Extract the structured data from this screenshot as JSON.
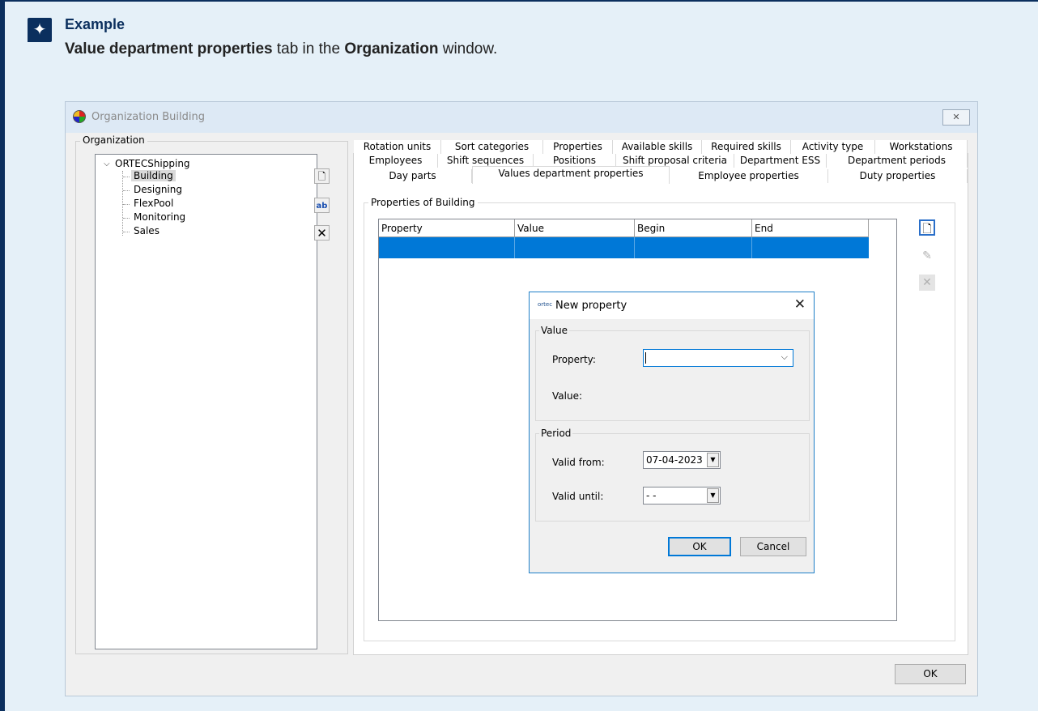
{
  "callout": {
    "icon": "star-icon",
    "title": "Example",
    "text_bold1": "Value department properties",
    "text_mid": " tab in the ",
    "text_bold2": "Organization",
    "text_end": " window."
  },
  "window": {
    "title": "Organization Building",
    "close_label": "X"
  },
  "organization": {
    "group_label": "Organization",
    "root": "ORTECShipping",
    "children": [
      "Building",
      "Designing",
      "FlexPool",
      "Monitoring",
      "Sales"
    ],
    "selected": "Building"
  },
  "tabs": {
    "row1": [
      "Rotation units",
      "Sort categories",
      "Properties",
      "Available skills",
      "Required skills",
      "Activity type",
      "Workstations"
    ],
    "row2": [
      "Employees",
      "Shift sequences",
      "Positions",
      "Shift proposal criteria",
      "Department ESS",
      "Department periods"
    ],
    "row3": [
      "Day parts",
      "Values department properties",
      "Employee properties",
      "Duty properties"
    ],
    "active": "Values department properties"
  },
  "properties": {
    "group_label": "Properties of Building",
    "columns": [
      "Property",
      "Value",
      "Begin",
      "End"
    ]
  },
  "dialog": {
    "title": "New property",
    "logo_text": "ortec",
    "close": "✕",
    "value_group": "Value",
    "property_label": "Property:",
    "property_value": "",
    "value_label": "Value:",
    "period_group": "Period",
    "valid_from_label": "Valid from:",
    "valid_from": "07-04-2023",
    "valid_until_label": "Valid until:",
    "valid_until": " - -",
    "ok": "OK",
    "cancel": "Cancel"
  },
  "footer": {
    "ok": "OK"
  },
  "colors": {
    "callout_bg": "#e5f0f8",
    "callout_accent": "#0b2f5e",
    "selection": "#0078d7"
  }
}
